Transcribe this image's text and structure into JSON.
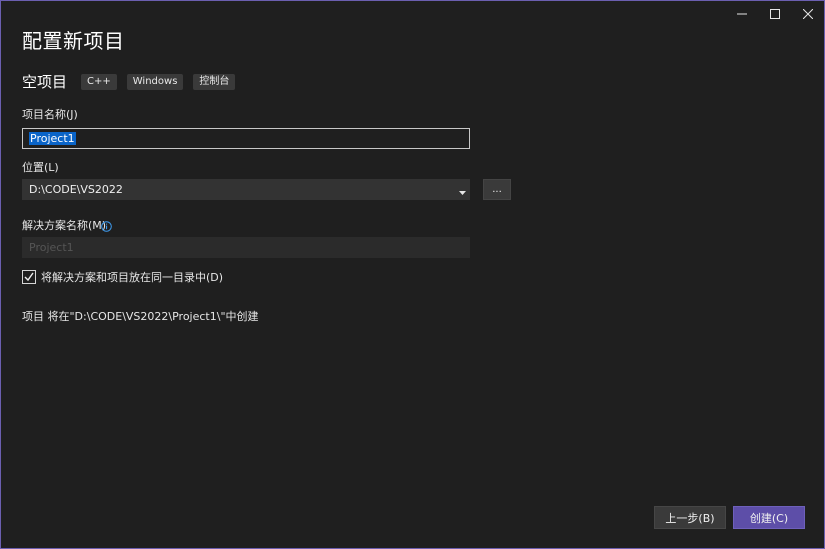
{
  "window": {
    "accent": "#6b5fb0",
    "background": "#1f1f1f"
  },
  "title_bar": {
    "minimize_icon": "minimize-icon",
    "maximize_icon": "maximize-icon",
    "close_icon": "close-icon"
  },
  "page_title": "配置新项目",
  "template": {
    "name": "空项目",
    "tags": [
      "C++",
      "Windows",
      "控制台"
    ]
  },
  "project_name": {
    "label": "项目名称(J)",
    "value": "Project1"
  },
  "location": {
    "label": "位置(L)",
    "value": "D:\\CODE\\VS2022",
    "browse_label": "..."
  },
  "solution_name": {
    "label": "解决方案名称(M)",
    "value": "Project1",
    "info_icon": "info-icon"
  },
  "same_dir": {
    "label": "将解决方案和项目放在同一目录中(D)",
    "checked": true
  },
  "path_note": "项目 将在\"D:\\CODE\\VS2022\\Project1\\\"中创建",
  "buttons": {
    "back": "上一步(B)",
    "create": "创建(C)"
  },
  "colors": {
    "create_button": "#5d4ea8",
    "selection": "#0a64c8",
    "info": "#3f9cf0"
  }
}
